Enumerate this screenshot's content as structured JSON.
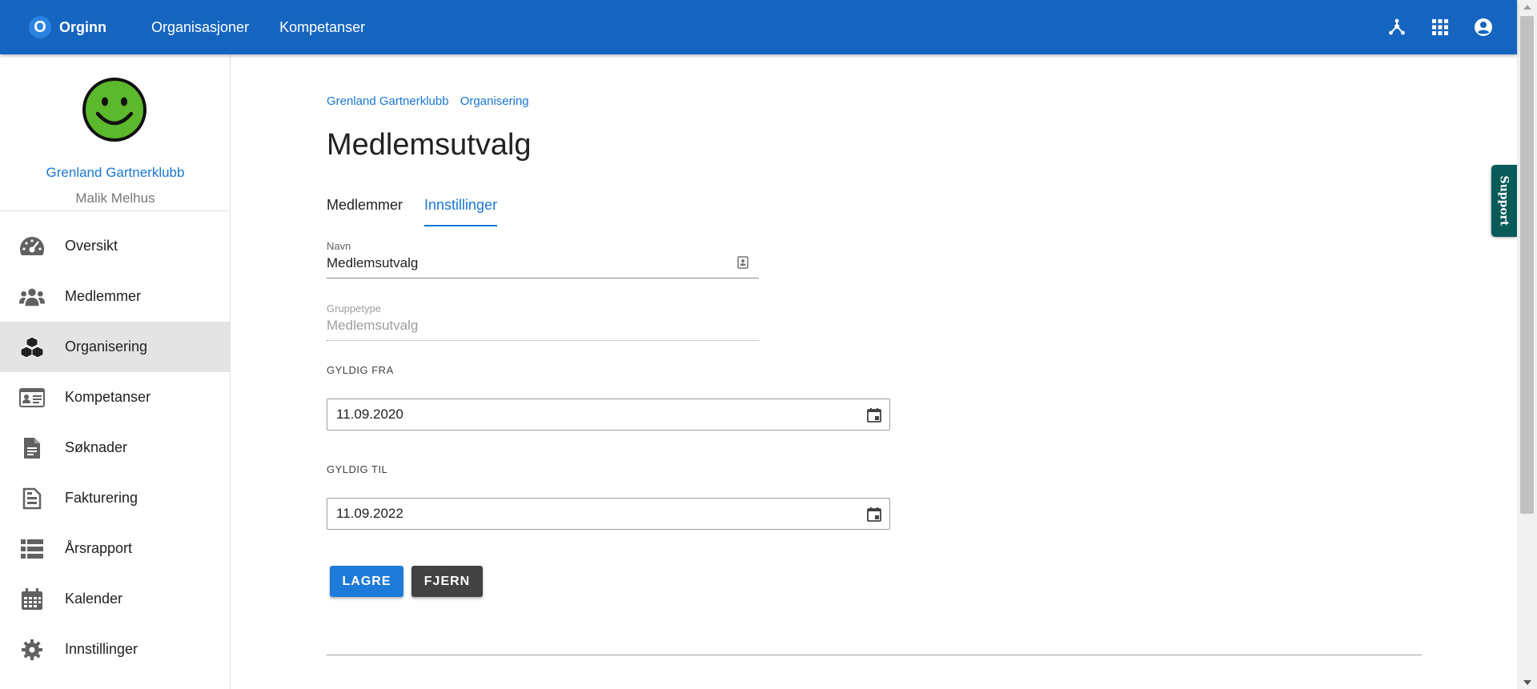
{
  "appbar": {
    "brand_letter": "O",
    "brand_name": "Orginn",
    "nav": [
      "Organisasjoner",
      "Kompetanser"
    ],
    "actions": [
      "hierarchy-icon",
      "apps-grid-icon",
      "account-circle-icon"
    ],
    "color": "#1565c0"
  },
  "sidebar": {
    "org_name": "Grenland Gartnerklubb",
    "user_name": "Malik Melhus",
    "avatar_icon": "smiley-face-icon",
    "items": [
      {
        "label": "Oversikt",
        "icon": "speedometer-icon"
      },
      {
        "label": "Medlemmer",
        "icon": "group-icon"
      },
      {
        "label": "Organisering",
        "icon": "cubes-icon",
        "active": true
      },
      {
        "label": "Kompetanser",
        "icon": "id-card-icon"
      },
      {
        "label": "Søknader",
        "icon": "document-icon"
      },
      {
        "label": "Fakturering",
        "icon": "invoice-icon"
      },
      {
        "label": "Årsrapport",
        "icon": "list-icon"
      },
      {
        "label": "Kalender",
        "icon": "calendar-icon"
      },
      {
        "label": "Innstillinger",
        "icon": "gear-icon"
      }
    ]
  },
  "breadcrumb": [
    "Grenland Gartnerklubb",
    "Organisering"
  ],
  "page_title": "Medlemsutvalg",
  "tabs": [
    {
      "label": "Medlemmer",
      "active": false
    },
    {
      "label": "Innstillinger",
      "active": true
    }
  ],
  "form": {
    "name": {
      "label": "Navn",
      "value": "Medlemsutvalg"
    },
    "group_type": {
      "label": "Gruppetype",
      "value": "Medlemsutvalg",
      "disabled": true
    },
    "valid_from": {
      "label": "GYLDIG FRA",
      "value": "11.09.2020"
    },
    "valid_to": {
      "label": "GYLDIG TIL",
      "value": "11.09.2022"
    }
  },
  "buttons": {
    "save": "LAGRE",
    "remove": "FJERN"
  },
  "support_label": "Support",
  "colors": {
    "primary": "#1976d2",
    "appbar": "#1565c0",
    "support": "#0a5a5a",
    "remove_button": "#424242"
  }
}
